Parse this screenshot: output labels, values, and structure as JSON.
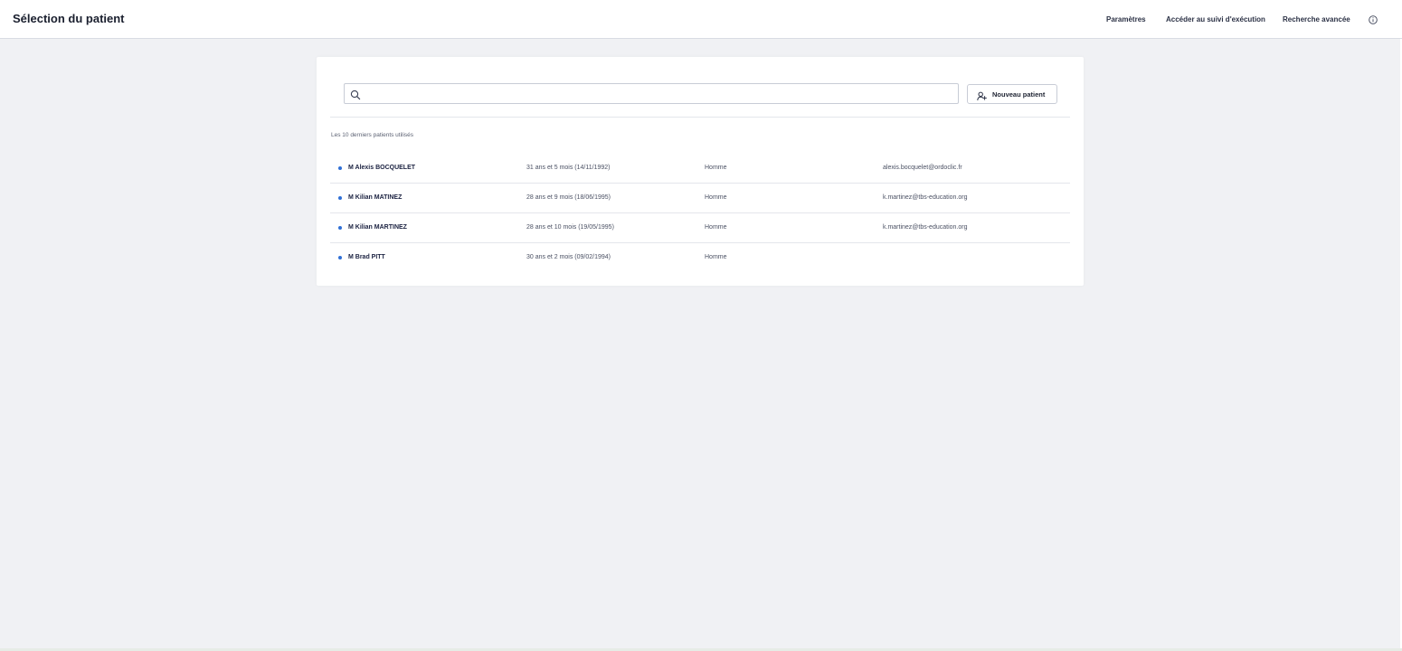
{
  "header": {
    "title": "Sélection du patient",
    "nav": {
      "parametres": "Paramètres",
      "suivi": "Accéder au suivi d'exécution",
      "recherche": "Recherche avancée"
    }
  },
  "search": {
    "placeholder": "",
    "value": ""
  },
  "new_patient_button": "Nouveau patient",
  "recent_label": "Les 10 derniers patients utilisés",
  "patients": [
    {
      "name": "M Alexis BOCQUELET",
      "age": "31 ans et 5 mois (14/11/1992)",
      "sex": "Homme",
      "email": "alexis.bocquelet@ordoclic.fr"
    },
    {
      "name": "M Kilian MATINEZ",
      "age": "28 ans et 9 mois (18/06/1995)",
      "sex": "Homme",
      "email": "k.martinez@tbs-education.org"
    },
    {
      "name": "M Kilian MARTINEZ",
      "age": "28 ans et 10 mois (19/05/1995)",
      "sex": "Homme",
      "email": "k.martinez@tbs-education.org"
    },
    {
      "name": "M Brad PITT",
      "age": "30 ans et 2 mois (09/02/1994)",
      "sex": "Homme",
      "email": ""
    }
  ],
  "colors": {
    "accent": "#2f6fd6",
    "background": "#f0f1f4",
    "card": "#ffffff"
  },
  "icons": [
    "search-icon",
    "user-plus-icon",
    "info-icon",
    "bullet-dot"
  ]
}
